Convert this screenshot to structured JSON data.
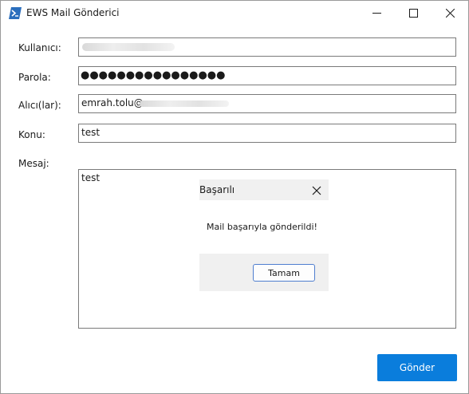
{
  "window": {
    "title": "EWS Mail Gönderici"
  },
  "form": {
    "username_label": "Kullanıcı:",
    "username_value": "",
    "password_label": "Parola:",
    "password_value": "●●●●●●●●●●●●●●●●",
    "recipients_label": "Alıcı(lar):",
    "recipients_value": "emrah.tolu@",
    "subject_label": "Konu:",
    "subject_value": "test",
    "message_label": "Mesaj:",
    "message_value": "test"
  },
  "dialog": {
    "title": "Başarılı",
    "message": "Mail başarıyla gönderildi!",
    "ok_label": "Tamam"
  },
  "actions": {
    "send_label": "Gönder"
  },
  "colors": {
    "accent": "#0a7ddc",
    "dialog_band": "#f0f0f0"
  },
  "icons": {
    "app": "powershell-icon",
    "minimize": "minimize-icon",
    "maximize": "maximize-icon",
    "close": "close-icon"
  }
}
